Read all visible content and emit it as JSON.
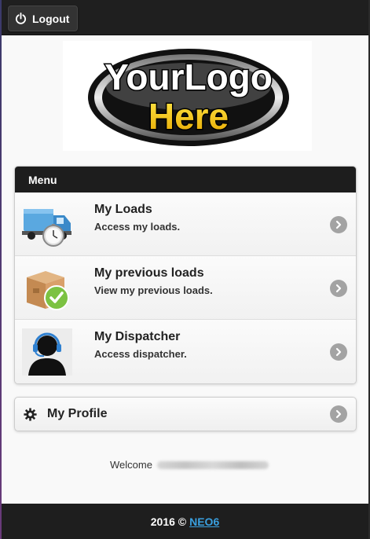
{
  "header": {
    "logout_label": "Logout",
    "logout_icon": "power-icon"
  },
  "logo": {
    "line1": "YourLogo",
    "line2": "Here"
  },
  "menu": {
    "title": "Menu",
    "items": [
      {
        "title": "My Loads",
        "description": "Access my loads.",
        "icon": "truck-icon"
      },
      {
        "title": "My previous loads",
        "description": "View my previous loads.",
        "icon": "box-check-icon"
      },
      {
        "title": "My Dispatcher",
        "description": "Access dispatcher.",
        "icon": "headset-person-icon"
      }
    ]
  },
  "profile": {
    "label": "My Profile",
    "icon": "gear-icon"
  },
  "welcome": {
    "label": "Welcome"
  },
  "footer": {
    "year_text": "2016 ©",
    "link_text": "NEO6"
  },
  "colors": {
    "header_bg": "#1f1f1f",
    "link": "#3aa0e0",
    "arrow": "#a3a3a3"
  }
}
